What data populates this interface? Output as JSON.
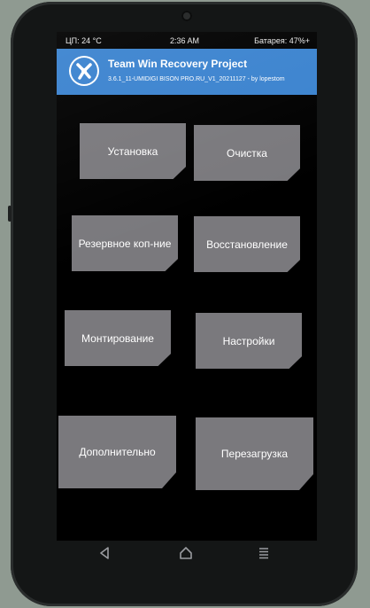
{
  "status": {
    "cpu": "ЦП: 24 °C",
    "time": "2:36 AM",
    "battery": "Батарея: 47%+"
  },
  "header": {
    "title": "Team Win Recovery Project",
    "subtitle": "3.6.1_11-UMIDIGI BISON PRO.RU_V1_20211127 - by lopestom",
    "logo": "twrp-logo-icon"
  },
  "menu": {
    "install": "Установка",
    "wipe": "Очистка",
    "backup": "Резервное коп-ние",
    "restore": "Восстановление",
    "mount": "Монтирование",
    "settings": "Настройки",
    "advanced": "Дополнительно",
    "reboot": "Перезагрузка"
  },
  "navigation": {
    "back": "back-icon",
    "home": "home-icon",
    "menu": "menu-icon"
  },
  "colors": {
    "header": "#3b83cf",
    "tile": "#7a797d",
    "screen": "#000000"
  }
}
